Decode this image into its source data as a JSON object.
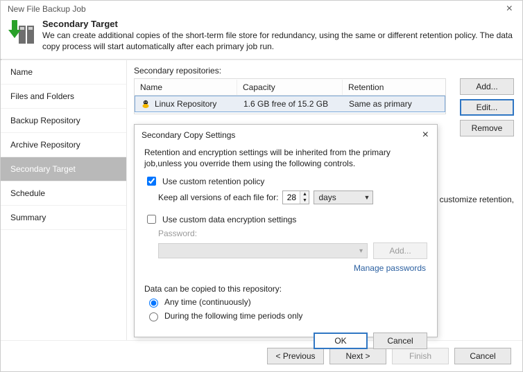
{
  "window": {
    "title": "New File Backup Job",
    "close_glyph": "×"
  },
  "header": {
    "title": "Secondary Target",
    "description": "We can create additional copies of the short-term file store for redundancy, using the same or different retention policy. The data copy process will start automatically after each primary job run."
  },
  "nav": {
    "items": [
      {
        "label": "Name"
      },
      {
        "label": "Files and Folders"
      },
      {
        "label": "Backup Repository"
      },
      {
        "label": "Archive Repository"
      },
      {
        "label": "Secondary Target"
      },
      {
        "label": "Schedule"
      },
      {
        "label": "Summary"
      }
    ],
    "active_index": 4
  },
  "main": {
    "section_label": "Secondary repositories:",
    "columns": {
      "name": "Name",
      "capacity": "Capacity",
      "retention": "Retention"
    },
    "rows": [
      {
        "icon": "linux-repo-icon",
        "name": "Linux Repository",
        "capacity": "1.6 GB free of 15.2 GB",
        "retention": "Same as primary"
      }
    ],
    "buttons": {
      "add": "Add...",
      "edit": "Edit...",
      "remove": "Remove"
    },
    "customize_note": "customize retention,"
  },
  "dialog": {
    "title": "Secondary Copy Settings",
    "close_glyph": "×",
    "description": "Retention and encryption settings will be inherited from the primary job,unless you override them using the following controls.",
    "custom_retention_checkbox": "Use custom retention policy",
    "custom_retention_checked": true,
    "keep_label": "Keep all versions of each file for:",
    "keep_value": "28",
    "keep_unit": "days",
    "custom_encryption_checkbox": "Use custom data encryption settings",
    "custom_encryption_checked": false,
    "password_label": "Password:",
    "add_password_btn": "Add...",
    "manage_passwords": "Manage passwords",
    "copy_schedule_label": "Data can be copied to this repository:",
    "radio_any": "Any time (continuously)",
    "radio_periods": "During the following time periods only",
    "radio_selected": "any",
    "ok": "OK",
    "cancel": "Cancel"
  },
  "footer": {
    "previous": "< Previous",
    "next": "Next >",
    "finish": "Finish",
    "cancel": "Cancel"
  }
}
